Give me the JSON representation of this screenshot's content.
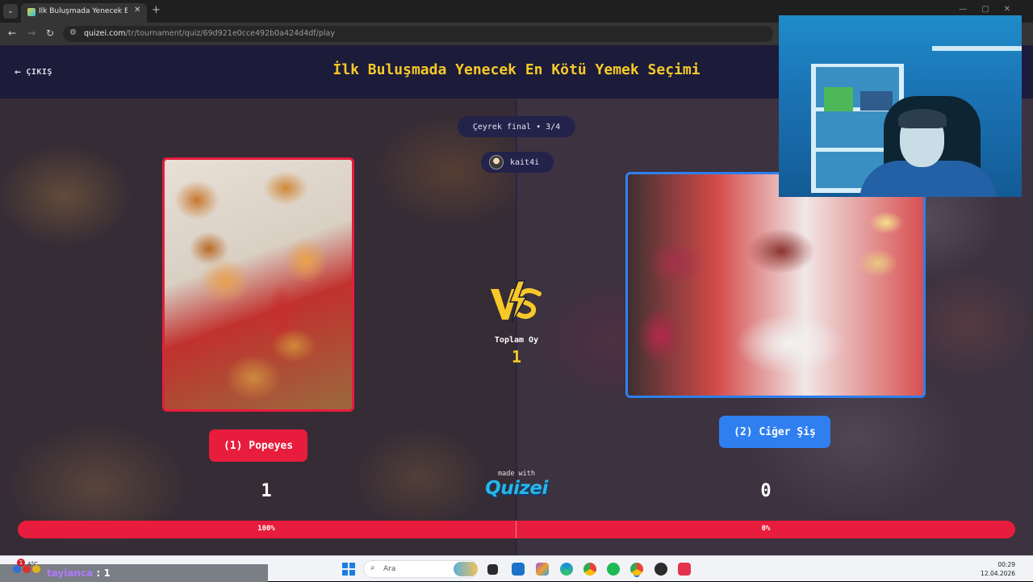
{
  "browser": {
    "tab_title": "İlk Buluşmada Yenecek En Kötü",
    "url_host": "quizei.com",
    "url_path": "/tr/tournament/quiz/69d921e0cce492b0a424d4df/play"
  },
  "header": {
    "exit_label": "ÇIKIŞ",
    "title": "İlk Buluşmada Yenecek En Kötü Yemek Seçimi"
  },
  "round": {
    "label": "Çeyrek final • 3/4"
  },
  "user": {
    "name": "kait4i"
  },
  "left_choice": {
    "label": "(1) Popeyes",
    "votes": "1",
    "percent": "100%"
  },
  "right_choice": {
    "label": "(2) Ciğer Şiş",
    "votes": "0",
    "percent": "0%"
  },
  "totals": {
    "label": "Toplam Oy",
    "value": "1"
  },
  "vote_share_left": 1.0,
  "footer": {
    "made_with": "made with",
    "brand": "Quizei"
  },
  "colors": {
    "title_yellow": "#f7c928",
    "left_red": "#e81c3c",
    "right_blue": "#2f7ff0",
    "header_bg": "#1c1b3a"
  },
  "taskbar": {
    "notification_count": "1",
    "weather": "4°C",
    "overlay_name": "tayianca",
    "overlay_sep": ":",
    "overlay_value": "1",
    "search_placeholder": "Ara",
    "time": "00:29",
    "date": "12.04.2026"
  }
}
